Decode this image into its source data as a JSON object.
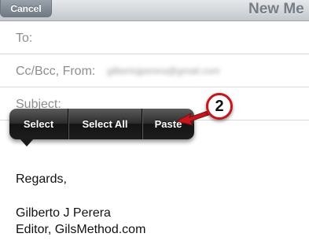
{
  "navbar": {
    "cancel_label": "Cancel",
    "title": "New Me"
  },
  "fields": {
    "to_label": "To:",
    "ccbcc_label": "Cc/Bcc, From:",
    "from_value": "gilbertojperera@gmail.com",
    "subject_label": "Subject:"
  },
  "popover": {
    "select_label": "Select",
    "select_all_label": "Select All",
    "paste_label": "Paste"
  },
  "body": {
    "line1": "Regards,",
    "line2": "Gilberto J Perera",
    "line3": "Editor, GilsMethod.com"
  },
  "callout": {
    "step_number": "2",
    "accent_color": "#c8161d"
  }
}
